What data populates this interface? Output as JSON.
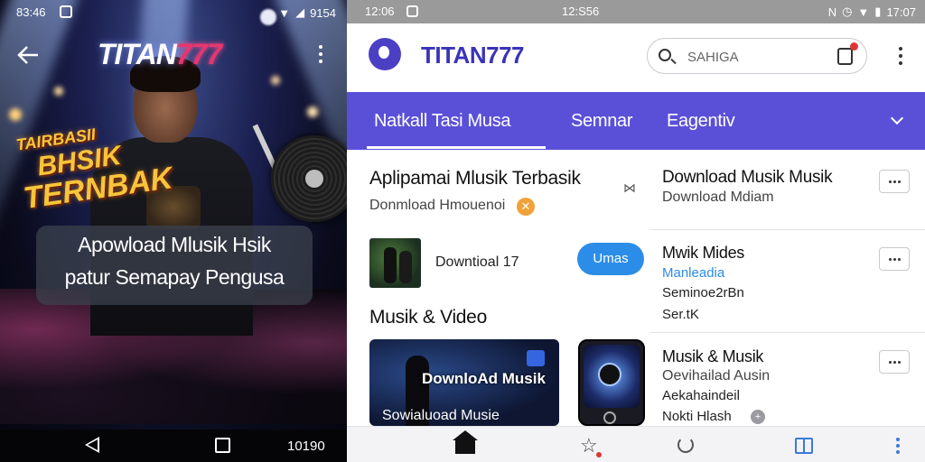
{
  "left_screen": {
    "status_bar": {
      "time": "83:46",
      "right_text": "9154"
    },
    "brand": {
      "main": "TITAN",
      "accent": "777"
    },
    "logo_art": {
      "line1": "TAIRBASII",
      "line2": "BHSIK",
      "line3": "TERNBAK"
    },
    "overlay": {
      "line1": "Apowload Mlusik Hsik",
      "line2": "patur Semapay Pengusa"
    },
    "nav_bar": {
      "number": "10190"
    }
  },
  "right_screen": {
    "status_bar": {
      "time": "12:06",
      "center": "12:S56",
      "right_text": "17:07"
    },
    "app_bar": {
      "brand": "TITAN777",
      "search_placeholder": "SAHIGA"
    },
    "tabs": [
      {
        "label": "Natkall Tasi Musa",
        "active": true
      },
      {
        "label": "Semnar",
        "active": false
      },
      {
        "label": "Eagentiv",
        "active": false
      }
    ],
    "featured": {
      "title": "Aplipamai Mlusik Terbasik",
      "subtitle": "Donmload Hmouenoi",
      "badge": "✕"
    },
    "download_row": {
      "label": "Downtioal 17",
      "button": "Umas"
    },
    "section_heading": "Musik & Video",
    "video_card": {
      "title": "DownloAd Musik",
      "caption": "Sowialuoad Musie"
    },
    "side_list": [
      {
        "title": "Download Musik Musik",
        "subtitle": "Download Mdiam"
      },
      {
        "title": "Mwik Mides",
        "link": "Manleadia",
        "meta1": "Seminoe2rBn",
        "meta2": "Ser.tK"
      },
      {
        "title": "Musik & Musik",
        "subtitle": "Oevihailad Ausin",
        "meta1": "Aekahaindeil",
        "meta2": "Nokti Hlash"
      }
    ],
    "colors": {
      "brand": "#3a33b8",
      "tab_bar": "#5a50d8",
      "pill": "#2c8de8"
    }
  }
}
